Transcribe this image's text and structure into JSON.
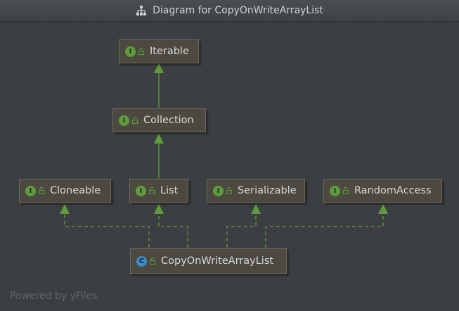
{
  "window": {
    "title": "Diagram for CopyOnWriteArrayList"
  },
  "nodes": {
    "iterable": {
      "label": "Iterable",
      "kind_letter": "I"
    },
    "collection": {
      "label": "Collection",
      "kind_letter": "I"
    },
    "cloneable": {
      "label": "Cloneable",
      "kind_letter": "I"
    },
    "list": {
      "label": "List",
      "kind_letter": "I"
    },
    "serializable": {
      "label": "Serializable",
      "kind_letter": "I"
    },
    "random_access": {
      "label": "RandomAccess",
      "kind_letter": "I"
    },
    "cowal": {
      "label": "CopyOnWriteArrayList",
      "kind_letter": "C"
    }
  },
  "edges": [
    {
      "from": "Collection",
      "to": "Iterable",
      "style": "solid"
    },
    {
      "from": "List",
      "to": "Collection",
      "style": "solid"
    },
    {
      "from": "CopyOnWriteArrayList",
      "to": "Cloneable",
      "style": "dashed"
    },
    {
      "from": "CopyOnWriteArrayList",
      "to": "List",
      "style": "dashed"
    },
    {
      "from": "CopyOnWriteArrayList",
      "to": "Serializable",
      "style": "dashed"
    },
    {
      "from": "CopyOnWriteArrayList",
      "to": "RandomAccess",
      "style": "dashed"
    }
  ],
  "footer": {
    "text": "Powered by yFiles"
  },
  "colors": {
    "background": "#3c3f41",
    "node_fill": "#4c4a40",
    "node_border": "#6b6a5d",
    "edge": "#5f9b3f",
    "interface_badge": "#5f9b3f",
    "class_badge": "#3e8cc7"
  },
  "icons": {
    "title": "hierarchy-icon",
    "interface": "interface-badge-icon",
    "class": "class-badge-icon",
    "access": "unlock-icon"
  }
}
